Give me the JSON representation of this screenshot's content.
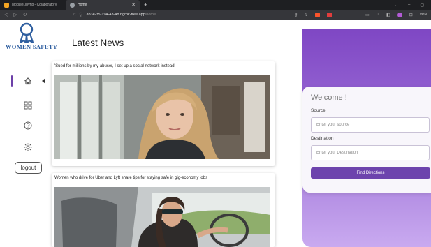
{
  "browser": {
    "tabs": [
      {
        "label": "ModuleI.ipynb - Colaboratory"
      },
      {
        "label": "Home"
      }
    ],
    "url_host": "3b3e-35-194-43-4b.ngrok-free.app",
    "url_path": "/home",
    "vpn_label": "VPN"
  },
  "colors": {
    "accent": "#6d43ad",
    "sidebar_active": "#6c3fa8",
    "logo": "#2f5fa0",
    "panel_gradient_top": "#7f47c4",
    "panel_gradient_bottom": "#c9aaf0"
  },
  "sidebar": {
    "logo_text": "WOMEN SAFETY",
    "logo_icon": "award-ribbon-icon",
    "items": [
      {
        "icon": "home-icon",
        "active": true
      },
      {
        "icon": "dashboard-grid-icon"
      },
      {
        "icon": "help-circle-icon"
      },
      {
        "icon": "sun-settings-icon"
      }
    ],
    "logout_label": "logout"
  },
  "main": {
    "heading": "Latest News",
    "news": [
      {
        "title": "'Sued for millions by my abuser, I set up a social network instead'"
      },
      {
        "title": "Women who drive for Uber and Lyft share tips for staying safe in gig-economy jobs"
      }
    ]
  },
  "panel": {
    "welcome": "Welcome !",
    "source_label": "Source",
    "source_placeholder": "Enter your source",
    "destination_label": "Destination",
    "destination_placeholder": "Enter your Destination",
    "button_label": "Find Directions"
  }
}
